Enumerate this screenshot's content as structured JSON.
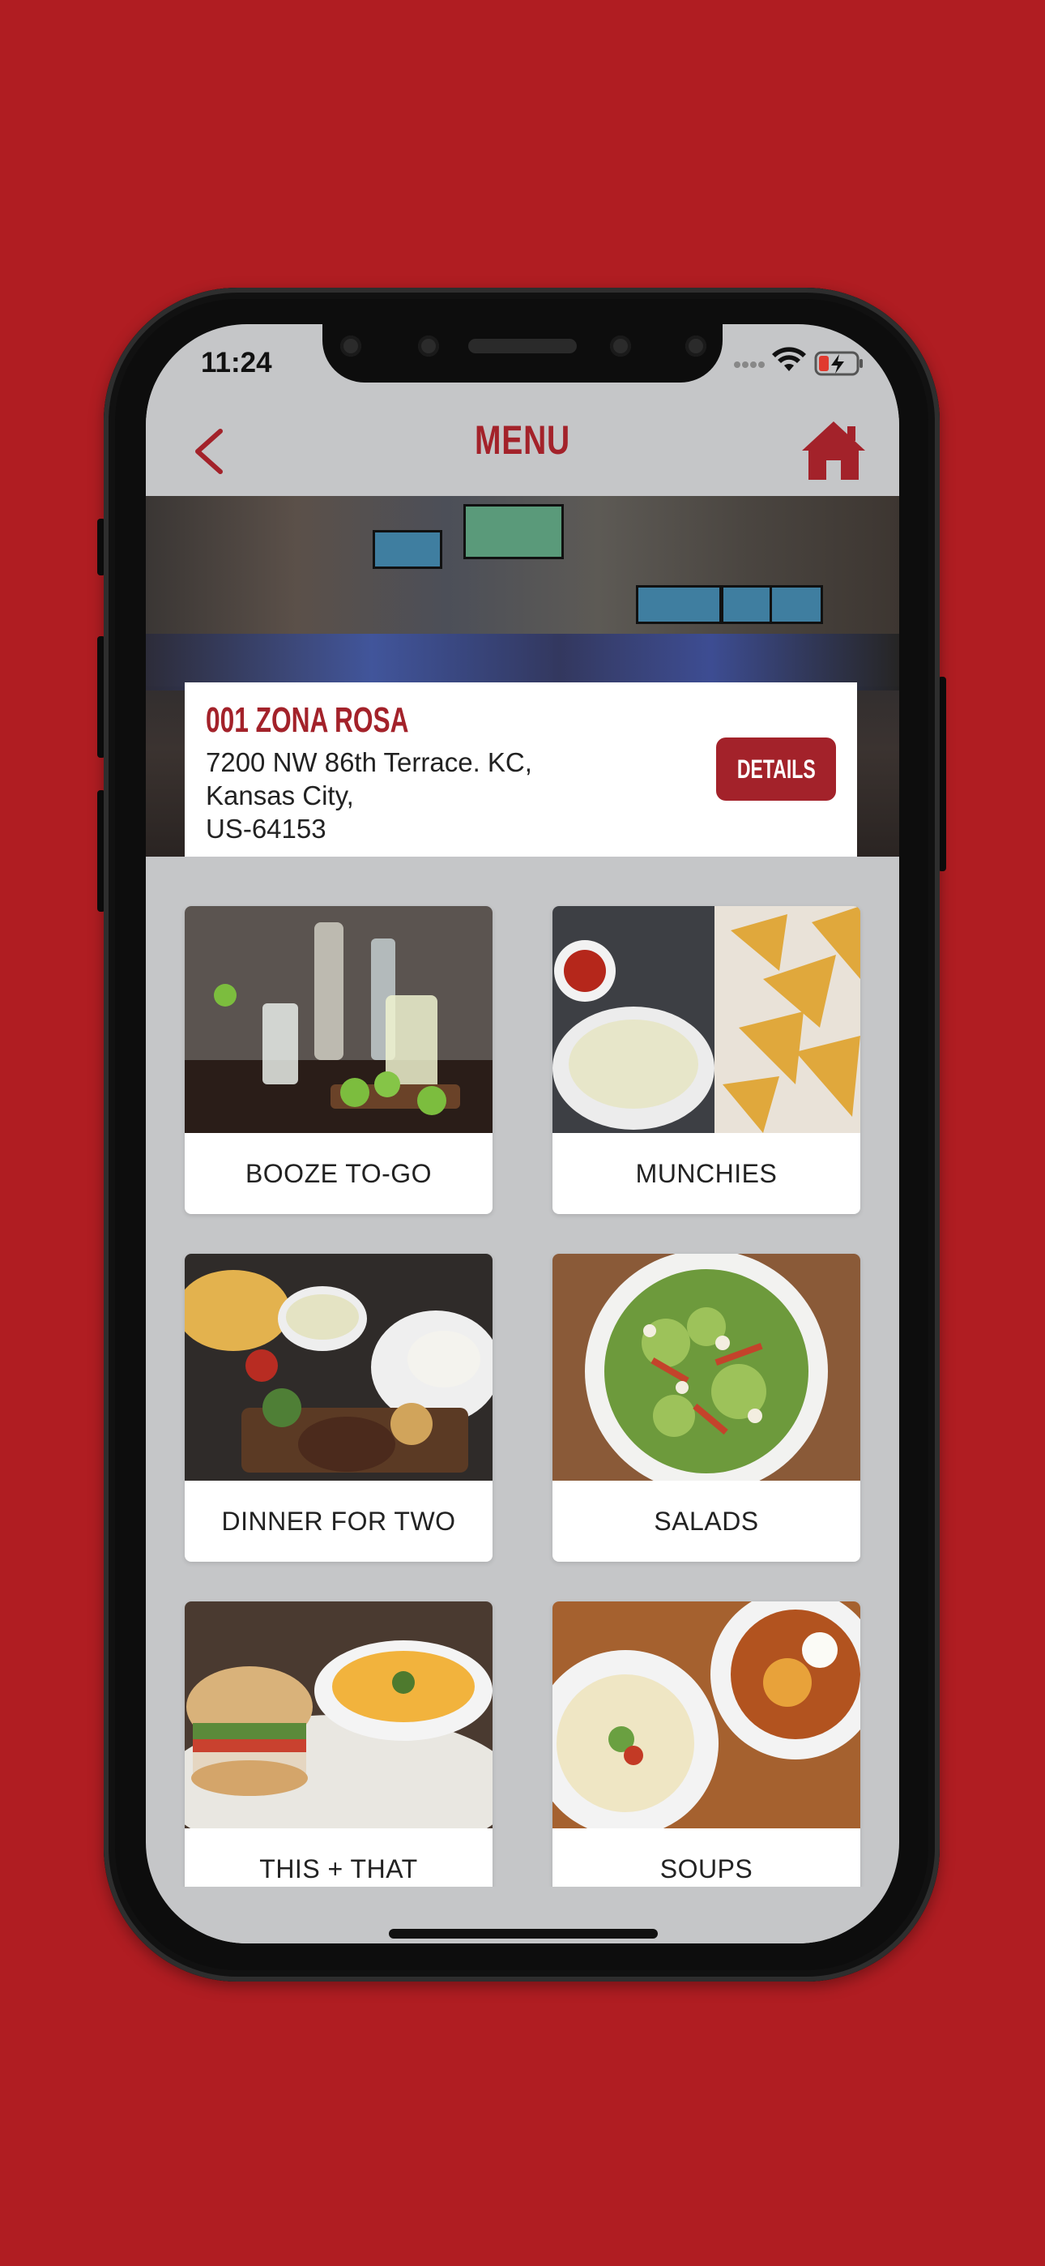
{
  "status_bar": {
    "time": "11:24"
  },
  "header": {
    "title": "MENU"
  },
  "store": {
    "name": "001 ZONA ROSA",
    "address_line1": "7200 NW 86th Terrace. KC,",
    "address_line2": "Kansas City,",
    "address_line3": "US-64153",
    "details_label": "DETAILS"
  },
  "categories": [
    {
      "label": "BOOZE TO-GO"
    },
    {
      "label": "MUNCHIES"
    },
    {
      "label": "DINNER FOR TWO"
    },
    {
      "label": "SALADS"
    },
    {
      "label": "THIS + THAT"
    },
    {
      "label": "SOUPS"
    }
  ],
  "colors": {
    "background": "#b01d22",
    "accent": "#a3222a",
    "screen": "#c5c6c8"
  },
  "icons": {
    "back": "chevron-left-icon",
    "home": "home-icon"
  }
}
